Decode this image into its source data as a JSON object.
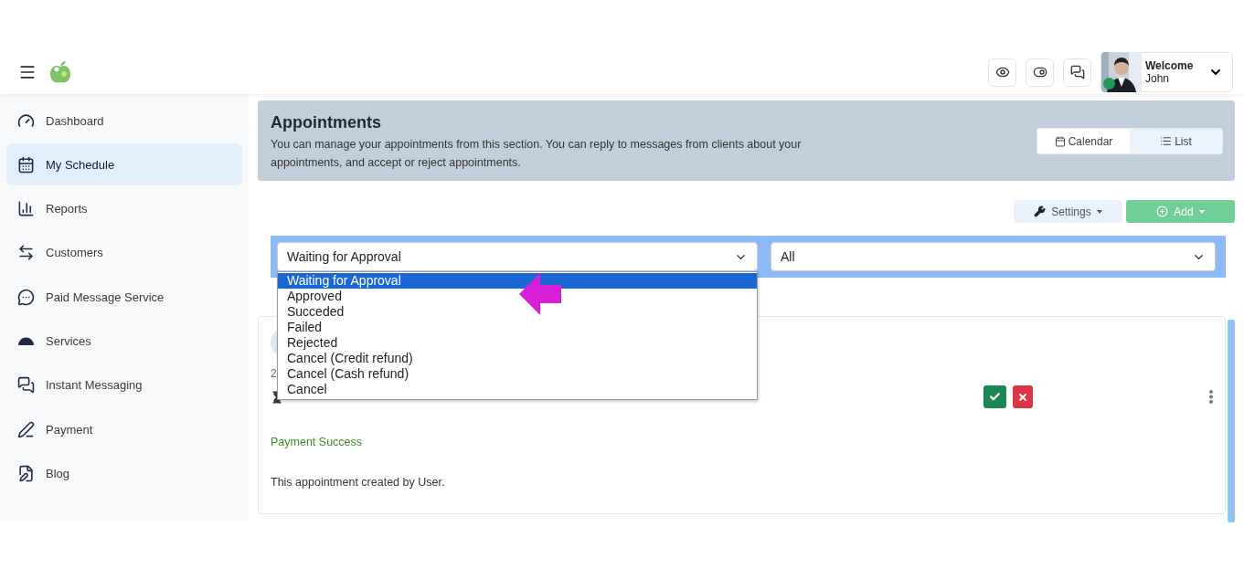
{
  "header": {
    "user": {
      "greeting": "Welcome",
      "name": "John",
      "online": true
    }
  },
  "sidebar": {
    "items": [
      {
        "label": "Dashboard",
        "selected": false
      },
      {
        "label": "My Schedule",
        "selected": true
      },
      {
        "label": "Reports",
        "selected": false
      },
      {
        "label": "Customers",
        "selected": false
      },
      {
        "label": "Paid Message Service",
        "selected": false
      },
      {
        "label": "Services",
        "selected": false
      },
      {
        "label": "Instant Messaging",
        "selected": false
      },
      {
        "label": "Payment",
        "selected": false
      },
      {
        "label": "Blog",
        "selected": false
      }
    ]
  },
  "banner": {
    "title": "Appointments",
    "description": "You can manage your appointments from this section. You can reply to messages from clients about your appointments, and accept or reject appointments.",
    "views": [
      {
        "label": "Calendar",
        "selected": false
      },
      {
        "label": "List",
        "selected": true
      }
    ]
  },
  "toolbar": {
    "settings": "Settings",
    "add": "Add"
  },
  "filters": {
    "status": {
      "value": "Waiting for Approval",
      "expanded": true,
      "options": [
        {
          "label": "Waiting for Approval",
          "selected": true
        },
        {
          "label": "Approved",
          "selected": false
        },
        {
          "label": "Succeded",
          "selected": false
        },
        {
          "label": "Failed",
          "selected": false
        },
        {
          "label": "Rejected",
          "selected": false
        },
        {
          "label": "Cancel (Credit refund)",
          "selected": false
        },
        {
          "label": "Cancel (Cash refund)",
          "selected": false
        },
        {
          "label": "Cancel",
          "selected": false
        }
      ]
    },
    "type": {
      "value": "All"
    }
  },
  "appointment": {
    "date_fragment": "2",
    "payment_status": "Payment Success",
    "note": "This appointment created by User."
  }
}
